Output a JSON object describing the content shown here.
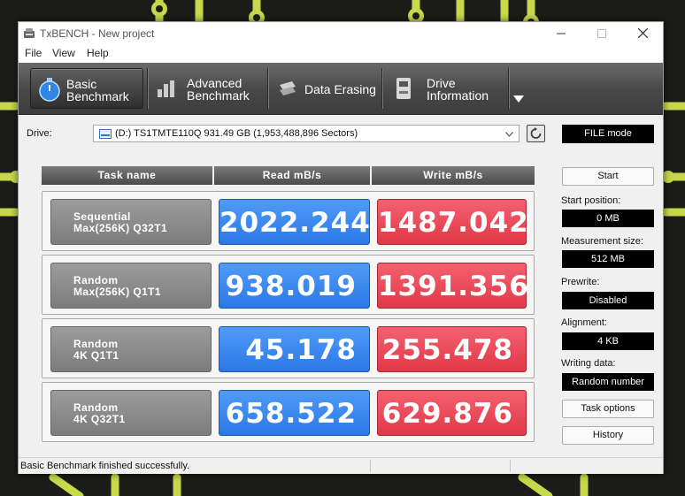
{
  "window": {
    "title": "TxBENCH - New project"
  },
  "menu": [
    "File",
    "View",
    "Help"
  ],
  "toolbar": {
    "tabs": [
      {
        "line1": "Basic",
        "line2": "Benchmark",
        "icon": "stopwatch-icon",
        "active": true
      },
      {
        "line1": "Advanced",
        "line2": "Benchmark",
        "icon": "bar-chart-icon",
        "active": false
      },
      {
        "line1": "Data Erasing",
        "line2": "",
        "icon": "eraser-icon",
        "active": false
      },
      {
        "line1": "Drive",
        "line2": "Information",
        "icon": "drive-icon",
        "active": false
      }
    ],
    "more_icon": "dropdown-arrow-icon"
  },
  "drive": {
    "label": "Drive:",
    "selected": "(D:) TS1TMTE110Q  931.49 GB (1,953,488,896 Sectors)",
    "mode": "FILE mode"
  },
  "table": {
    "headers": [
      "Task name",
      "Read mB/s",
      "Write mB/s"
    ],
    "rows": [
      {
        "task_line1": "Sequential",
        "task_line2": "Max(256K) Q32T1",
        "read": "2022.244",
        "write": "1487.042"
      },
      {
        "task_line1": "Random",
        "task_line2": "Max(256K) Q1T1",
        "read": "938.019",
        "write": "1391.356"
      },
      {
        "task_line1": "Random",
        "task_line2": "4K Q1T1",
        "read": "45.178",
        "write": "255.478"
      },
      {
        "task_line1": "Random",
        "task_line2": "4K Q32T1",
        "read": "658.522",
        "write": "629.876"
      }
    ]
  },
  "settings": {
    "start_button": "Start",
    "start_position_label": "Start position:",
    "start_position": "0 MB",
    "measurement_size_label": "Measurement size:",
    "measurement_size": "512 MB",
    "prewrite_label": "Prewrite:",
    "prewrite": "Disabled",
    "alignment_label": "Alignment:",
    "alignment": "4 KB",
    "writing_data_label": "Writing data:",
    "writing_data": "Random number",
    "task_options_button": "Task options",
    "history_button": "History"
  },
  "status": {
    "text": "Basic Benchmark finished successfully."
  },
  "colors": {
    "read": "#2b78e6",
    "write": "#e13846",
    "toolbar": "#4a4a4a"
  }
}
